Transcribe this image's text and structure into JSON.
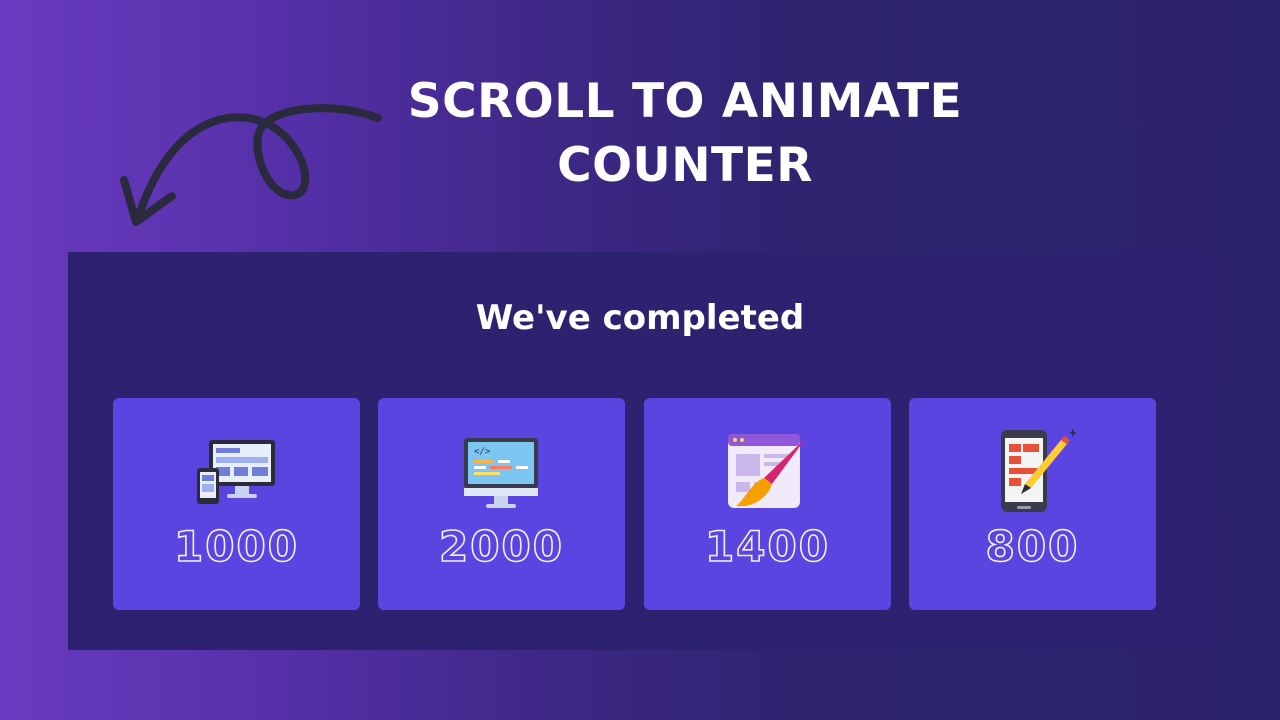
{
  "headline": {
    "line1": "SCROLL TO ANIMATE",
    "line2": "COUNTER"
  },
  "panel": {
    "title": "We've completed"
  },
  "counters": [
    {
      "value": "1000",
      "icon": "responsive-devices-icon"
    },
    {
      "value": "2000",
      "icon": "code-monitor-icon"
    },
    {
      "value": "1400",
      "icon": "web-design-brush-icon"
    },
    {
      "value": "800",
      "icon": "mobile-design-pen-icon"
    }
  ],
  "colors": {
    "card": "#5b45e0",
    "panel": "#2c2270",
    "arrow": "#2a2a3e"
  }
}
